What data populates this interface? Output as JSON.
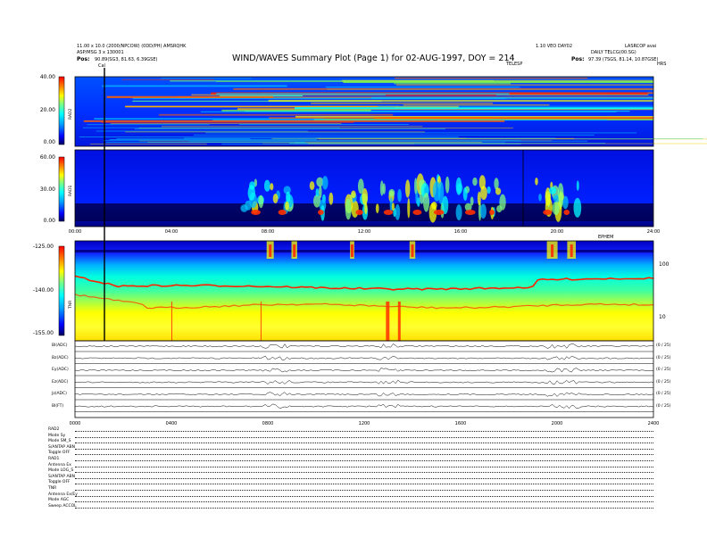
{
  "header": {
    "title": "WIND/WAVES Summary Plot (Page 1) for 02-AUG-1997, DOY = 214",
    "left_line1": "11.00 x 10.0 (2000/NPCOW) (0DD/PH) AMSRQHK",
    "left_line2": "ASP/MSG 3 x 130001",
    "left_line3_label": "Pos:",
    "left_line3_value": "90.89(SG3, 81.63, 6.39GSE)",
    "right_line1": "1.10 VEO DAY02",
    "right_line2": "DAILY TELCG(00.SG)",
    "right_line3_label": "Pos:",
    "right_line3_value": "97.39 (7SGS, 81.14, 10.87GSE)",
    "top_right_code": "LASRCOP avai",
    "marker_left": "Cal",
    "marker_top": "TELESP",
    "hrs_label": "HRS"
  },
  "panels": {
    "rad2": {
      "axis_label": "RAD2",
      "ticks": [
        "40.00",
        "20.00",
        "0.00"
      ]
    },
    "rad1": {
      "axis_label": "RAD1",
      "ticks": [
        "60.00",
        "30.00",
        "0.00"
      ]
    },
    "tnr": {
      "axis_label": "TNR",
      "ticks": [
        "-125.00",
        "-140.00",
        "-155.00"
      ],
      "right_ticks": [
        "100",
        "10"
      ],
      "xaxis_tag": "EPHEM"
    },
    "time_ticks": [
      "00:00",
      "04:00",
      "08:00",
      "12:00",
      "16:00",
      "20:00",
      "24:00"
    ],
    "bottom_time_ticks": [
      "0000",
      "0400",
      "0800",
      "1200",
      "1600",
      "2000",
      "2400"
    ]
  },
  "wave_rows": [
    {
      "label": "Bl(ADC)",
      "right": "(0 / 25)"
    },
    {
      "label": "Bz(ADC)",
      "right": "(0 / 25)"
    },
    {
      "label": "Ey(ADC)",
      "right": "(0 / 25)"
    },
    {
      "label": "Ez(ADC)",
      "right": "(0 / 25)"
    },
    {
      "label": "Jz(ADC)",
      "right": "(0 / 25)"
    },
    {
      "label": "Bl(FT)",
      "right": "(0 / 25)"
    }
  ],
  "settings": [
    "RAD2",
    "Mode   Sy",
    "Mode   SM_S",
    "S/ANTAP ABN",
    "Toggle   OFF",
    "RAD1",
    "Antenna   Ex",
    "Mode   LOG_S",
    "S/ANTAP ABN",
    "Toggle   OFF",
    "TNR",
    "Antenna   Ex/Ey",
    "Mode   AGC",
    "Sweep   ACCOL"
  ],
  "chart_data": [
    {
      "type": "heatmap",
      "title": "RAD2",
      "ylabel": "RAD2",
      "ylim": [
        0,
        40
      ],
      "x_range_hours": [
        0,
        24
      ],
      "colormap": [
        "#000060",
        "#0000ff",
        "#00a0ff",
        "#00ffff",
        "#80ff80",
        "#ffff00",
        "#ff8000",
        "#ff0000"
      ]
    },
    {
      "type": "heatmap",
      "title": "RAD1",
      "ylabel": "RAD1",
      "ylim": [
        0,
        60
      ],
      "x_range_hours": [
        0,
        24
      ],
      "colormap": [
        "#000060",
        "#0000ff",
        "#00a0ff",
        "#00ffff",
        "#80ff80",
        "#ffff00",
        "#ff8000",
        "#ff0000"
      ]
    },
    {
      "type": "heatmap",
      "title": "TNR",
      "ylabel": "TNR",
      "ylim": [
        -155,
        -125
      ],
      "x_range_hours": [
        0,
        24
      ],
      "colormap": [
        "#000060",
        "#0000ff",
        "#00a0ff",
        "#00ffff",
        "#80ff80",
        "#ffff00",
        "#ff8000",
        "#ff0000"
      ]
    }
  ]
}
